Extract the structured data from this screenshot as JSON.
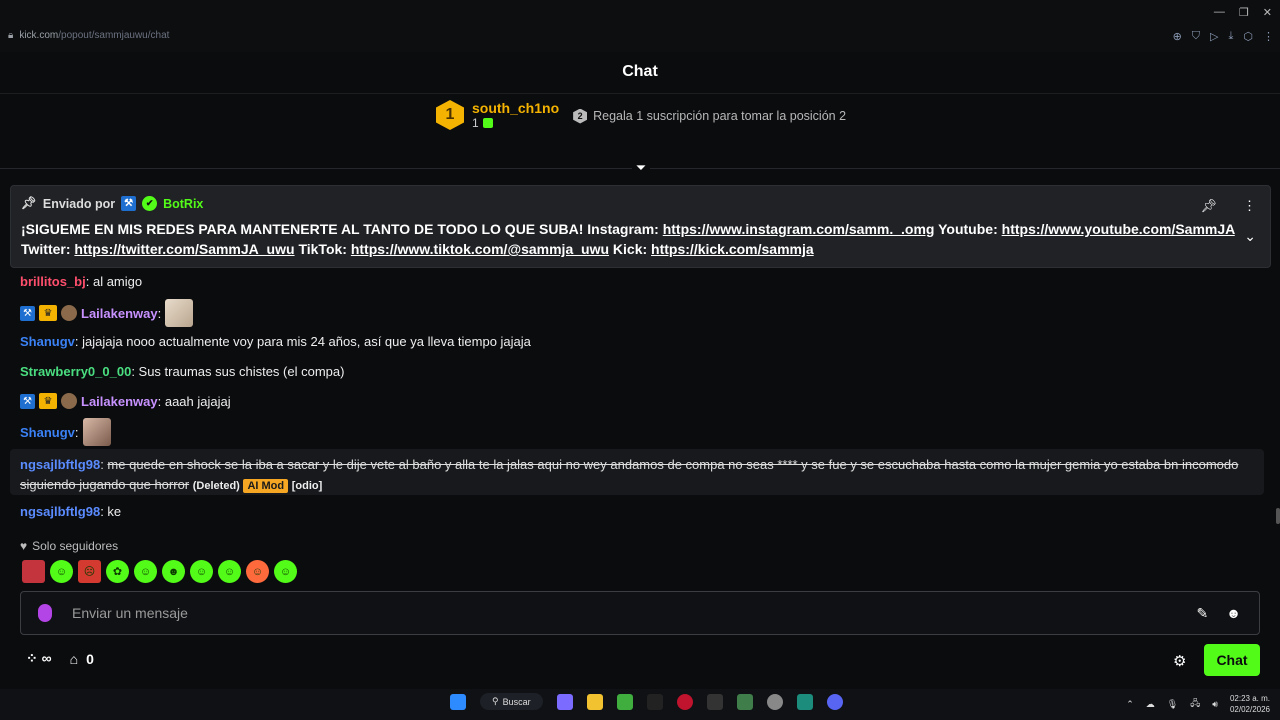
{
  "browser": {
    "url_host": "kick.com",
    "url_path": "/popout/sammjauwu/chat"
  },
  "header": {
    "title": "Chat"
  },
  "leaderboard": {
    "rank": "1",
    "name": "south_ch1no",
    "count": "1",
    "next_rank": "2",
    "next_text": "Regala 1 suscripción para tomar la posición 2"
  },
  "pinned": {
    "label": "Enviado por",
    "author": "BotRix",
    "text_1": "¡SIGUEME EN MIS REDES PARA MANTENERTE AL TANTO DE TODO LO QUE SUBA! Instagram: ",
    "link_1": "https://www.instagram.com/samm._.omg",
    "text_2": " Youtube: ",
    "link_2": "https://www.youtube.com/SammJA",
    "text_3": " Twitter: ",
    "link_3": "https://twitter.com/SammJA_uwu",
    "text_4": " TikTok: ",
    "link_4": "https://www.tiktok.com/@sammja_uwu",
    "text_5": " Kick: ",
    "link_5": "https://kick.com/sammja"
  },
  "messages": [
    {
      "user": "brillitos_bj",
      "text": ": al amigo"
    },
    {
      "user": "Lailakenway",
      "text": ":"
    },
    {
      "user": "Shanugv",
      "text": ": jajajaja nooo actualmente voy para mis 24 años, así que ya lleva tiempo jajaja"
    },
    {
      "user": "Strawberry0_0_00",
      "text": ": Sus traumas sus chistes (el compa)"
    },
    {
      "user": "Lailakenway",
      "text": ": aaah jajajaj"
    },
    {
      "user": "Shanugv",
      "text": ":"
    },
    {
      "user": "ngsajlbftlg98",
      "text": "me quede en shock se la iba a sacar y le dije vete al baño y alla te la jalas aqui no wey andamos de compa no seas **** y se fue y se escuchaba hasta como la mujer gemia yo estaba bn incomodo siguiendo jugando que horror",
      "deleted": "(Deleted)",
      "ai_mod": "AI Mod",
      "reason": "[odio]"
    },
    {
      "user": "ngsajlbftlg98",
      "text": ": ke"
    }
  ],
  "footer": {
    "followers_only": "Solo seguidores",
    "input_placeholder": "Enviar un mensaje",
    "points": "0",
    "chat_button": "Chat"
  },
  "taskbar": {
    "search_label": "Buscar",
    "time": "02:23 a. m.",
    "date": "02/02/2026"
  },
  "colors": {
    "accent": "#53fc18",
    "gold": "#f5b301",
    "ai_mod": "#f5a623"
  }
}
